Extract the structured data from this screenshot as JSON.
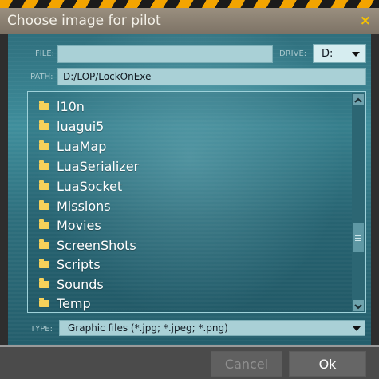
{
  "window": {
    "title": "Choose image for pilot",
    "close_glyph": "×"
  },
  "form": {
    "file_label": "FILE:",
    "file_value": "",
    "drive_label": "DRIVE:",
    "drive_value": "D:",
    "path_label": "PATH:",
    "path_value": "D:/LOP/LockOnExe",
    "type_label": "TYPE:",
    "type_value": "Graphic files (*.jpg; *.jpeg; *.png)"
  },
  "folders": [
    "l10n",
    "luagui5",
    "LuaMap",
    "LuaSerializer",
    "LuaSocket",
    "Missions",
    "Movies",
    "ScreenShots",
    "Scripts",
    "Sounds",
    "Temp"
  ],
  "icons": {
    "folder": "folder-icon",
    "scroll_up": "chevron-up-icon",
    "scroll_down": "chevron-down-icon",
    "dropdown": "dropdown-arrow-icon"
  },
  "buttons": {
    "cancel_label": "Cancel",
    "ok_label": "Ok"
  },
  "colors": {
    "accent_yellow": "#f6c200",
    "folder_yellow": "#f6d15a",
    "panel_teal": "#3f8e9c"
  }
}
